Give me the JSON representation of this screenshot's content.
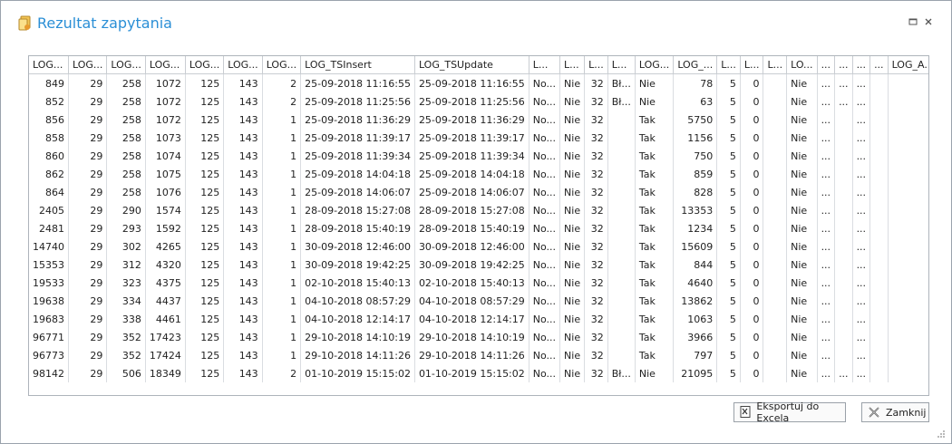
{
  "window": {
    "title": "Rezultat zapytania"
  },
  "grid": {
    "columns": [
      "LOG...",
      "LOG...",
      "LOG...",
      "LOG...",
      "LOG...",
      "LOG...",
      "LOG...",
      "LOG_TSInsert",
      "LOG_TSUpdate",
      "L...",
      "L...",
      "L...",
      "L...",
      "LOG...",
      "LOG_...",
      "L...",
      "L...",
      "L...",
      "LO...",
      "...",
      "...",
      "...",
      "...",
      "LOG_A..."
    ],
    "rows": [
      [
        "849",
        "29",
        "258",
        "1072",
        "125",
        "143",
        "2",
        "25-09-2018 11:16:55",
        "25-09-2018 11:16:55",
        "No...",
        "Nie",
        "32",
        "Bł...",
        "Nie",
        "78",
        "5",
        "0",
        "",
        "Nie",
        "...",
        "...",
        "...",
        "",
        ""
      ],
      [
        "852",
        "29",
        "258",
        "1072",
        "125",
        "143",
        "2",
        "25-09-2018 11:25:56",
        "25-09-2018 11:25:56",
        "No...",
        "Nie",
        "32",
        "Bł...",
        "Nie",
        "63",
        "5",
        "0",
        "",
        "Nie",
        "...",
        "...",
        "...",
        "",
        ""
      ],
      [
        "856",
        "29",
        "258",
        "1072",
        "125",
        "143",
        "1",
        "25-09-2018 11:36:29",
        "25-09-2018 11:36:29",
        "No...",
        "Nie",
        "32",
        "",
        "Tak",
        "5750",
        "5",
        "0",
        "",
        "Nie",
        "...",
        "",
        "...",
        "",
        ""
      ],
      [
        "858",
        "29",
        "258",
        "1073",
        "125",
        "143",
        "1",
        "25-09-2018 11:39:17",
        "25-09-2018 11:39:17",
        "No...",
        "Nie",
        "32",
        "",
        "Tak",
        "1156",
        "5",
        "0",
        "",
        "Nie",
        "...",
        "",
        "...",
        "",
        ""
      ],
      [
        "860",
        "29",
        "258",
        "1074",
        "125",
        "143",
        "1",
        "25-09-2018 11:39:34",
        "25-09-2018 11:39:34",
        "No...",
        "Nie",
        "32",
        "",
        "Tak",
        "750",
        "5",
        "0",
        "",
        "Nie",
        "...",
        "",
        "...",
        "",
        ""
      ],
      [
        "862",
        "29",
        "258",
        "1075",
        "125",
        "143",
        "1",
        "25-09-2018 14:04:18",
        "25-09-2018 14:04:18",
        "No...",
        "Nie",
        "32",
        "",
        "Tak",
        "859",
        "5",
        "0",
        "",
        "Nie",
        "...",
        "",
        "...",
        "",
        ""
      ],
      [
        "864",
        "29",
        "258",
        "1076",
        "125",
        "143",
        "1",
        "25-09-2018 14:06:07",
        "25-09-2018 14:06:07",
        "No...",
        "Nie",
        "32",
        "",
        "Tak",
        "828",
        "5",
        "0",
        "",
        "Nie",
        "...",
        "",
        "...",
        "",
        ""
      ],
      [
        "2405",
        "29",
        "290",
        "1574",
        "125",
        "143",
        "1",
        "28-09-2018 15:27:08",
        "28-09-2018 15:27:08",
        "No...",
        "Nie",
        "32",
        "",
        "Tak",
        "13353",
        "5",
        "0",
        "",
        "Nie",
        "...",
        "",
        "...",
        "",
        ""
      ],
      [
        "2481",
        "29",
        "293",
        "1592",
        "125",
        "143",
        "1",
        "28-09-2018 15:40:19",
        "28-09-2018 15:40:19",
        "No...",
        "Nie",
        "32",
        "",
        "Tak",
        "1234",
        "5",
        "0",
        "",
        "Nie",
        "...",
        "",
        "...",
        "",
        ""
      ],
      [
        "14740",
        "29",
        "302",
        "4265",
        "125",
        "143",
        "1",
        "30-09-2018 12:46:00",
        "30-09-2018 12:46:00",
        "No...",
        "Nie",
        "32",
        "",
        "Tak",
        "15609",
        "5",
        "0",
        "",
        "Nie",
        "...",
        "",
        "...",
        "",
        ""
      ],
      [
        "15353",
        "29",
        "312",
        "4320",
        "125",
        "143",
        "1",
        "30-09-2018 19:42:25",
        "30-09-2018 19:42:25",
        "No...",
        "Nie",
        "32",
        "",
        "Tak",
        "844",
        "5",
        "0",
        "",
        "Nie",
        "...",
        "",
        "...",
        "",
        ""
      ],
      [
        "19533",
        "29",
        "323",
        "4375",
        "125",
        "143",
        "1",
        "02-10-2018 15:40:13",
        "02-10-2018 15:40:13",
        "No...",
        "Nie",
        "32",
        "",
        "Tak",
        "4640",
        "5",
        "0",
        "",
        "Nie",
        "...",
        "",
        "...",
        "",
        ""
      ],
      [
        "19638",
        "29",
        "334",
        "4437",
        "125",
        "143",
        "1",
        "04-10-2018 08:57:29",
        "04-10-2018 08:57:29",
        "No...",
        "Nie",
        "32",
        "",
        "Tak",
        "13862",
        "5",
        "0",
        "",
        "Nie",
        "...",
        "",
        "...",
        "",
        ""
      ],
      [
        "19683",
        "29",
        "338",
        "4461",
        "125",
        "143",
        "1",
        "04-10-2018 12:14:17",
        "04-10-2018 12:14:17",
        "No...",
        "Nie",
        "32",
        "",
        "Tak",
        "1063",
        "5",
        "0",
        "",
        "Nie",
        "...",
        "",
        "...",
        "",
        ""
      ],
      [
        "96771",
        "29",
        "352",
        "17423",
        "125",
        "143",
        "1",
        "29-10-2018 14:10:19",
        "29-10-2018 14:10:19",
        "No...",
        "Nie",
        "32",
        "",
        "Tak",
        "3966",
        "5",
        "0",
        "",
        "Nie",
        "...",
        "",
        "...",
        "",
        ""
      ],
      [
        "96773",
        "29",
        "352",
        "17424",
        "125",
        "143",
        "1",
        "29-10-2018 14:11:26",
        "29-10-2018 14:11:26",
        "No...",
        "Nie",
        "32",
        "",
        "Tak",
        "797",
        "5",
        "0",
        "",
        "Nie",
        "...",
        "",
        "...",
        "",
        ""
      ],
      [
        "98142",
        "29",
        "506",
        "18349",
        "125",
        "143",
        "2",
        "01-10-2019 15:15:02",
        "01-10-2019 15:15:02",
        "No...",
        "Nie",
        "32",
        "Bł...",
        "Nie",
        "21095",
        "5",
        "0",
        "",
        "Nie",
        "...",
        "...",
        "...",
        "",
        ""
      ]
    ]
  },
  "buttons": {
    "export_label": "Eksportuj do Excela",
    "close_label": "Zamknij"
  },
  "colors": {
    "title": "#2b8fd6",
    "border": "#9aa3ad",
    "grid_line": "#dadde1"
  }
}
